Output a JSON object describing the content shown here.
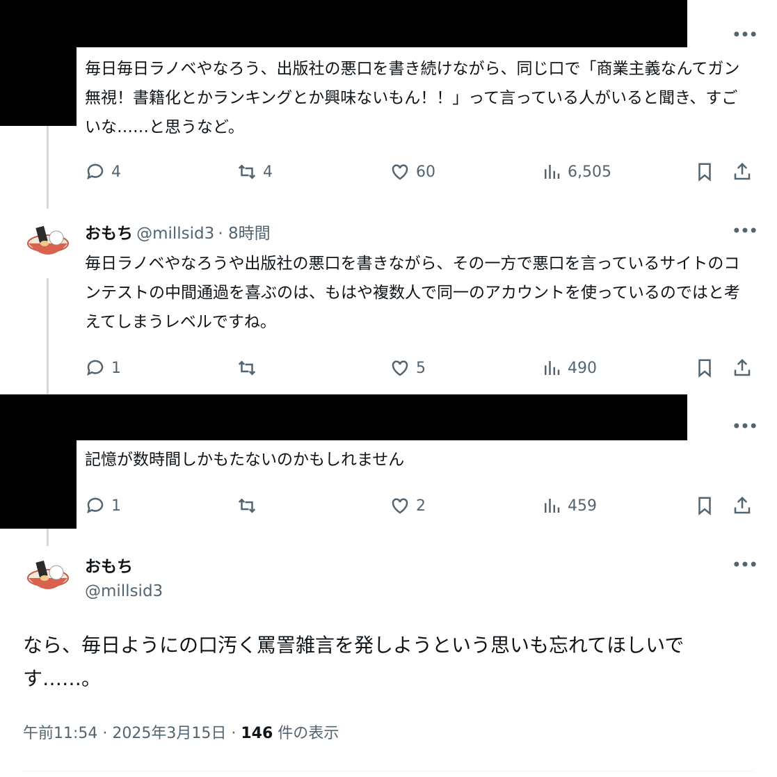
{
  "tweets": [
    {
      "text": "毎日毎日ラノベやなろう、出版社の悪口を書き続けながら、同じ口で「商業主義なんてガン無視！書籍化とかランキングとか興味ないもん！！」って言っている人がいると聞き、すごいな……と思うなど。",
      "replies": "4",
      "retweets": "4",
      "likes": "60",
      "views": "6,505"
    },
    {
      "name": "おもち",
      "handle": "@millsid3",
      "time": "· 8時間",
      "text": "毎日ラノベやなろうや出版社の悪口を書きながら、その一方で悪口を言っているサイトのコンテストの中間通過を喜ぶのは、もはや複数人で同一のアカウントを使っているのではと考えてしまうレベルですね。",
      "replies": "1",
      "retweets": "",
      "likes": "5",
      "views": "490"
    },
    {
      "text": "記憶が数時間しかもたないのかもしれません",
      "replies": "1",
      "retweets": "",
      "likes": "2",
      "views": "459"
    }
  ],
  "main": {
    "name": "おもち",
    "handle": "@millsid3",
    "text": "なら、毎日ようにの口汚く罵詈雑言を発しようという思いも忘れてほしいです……。",
    "time": "午前11:54 · 2025年3月15日 · ",
    "views_count": "146",
    "views_label": " 件の表示"
  },
  "colors": {
    "text": "#0f1419",
    "secondary": "#536471",
    "line": "#cfd9de"
  }
}
